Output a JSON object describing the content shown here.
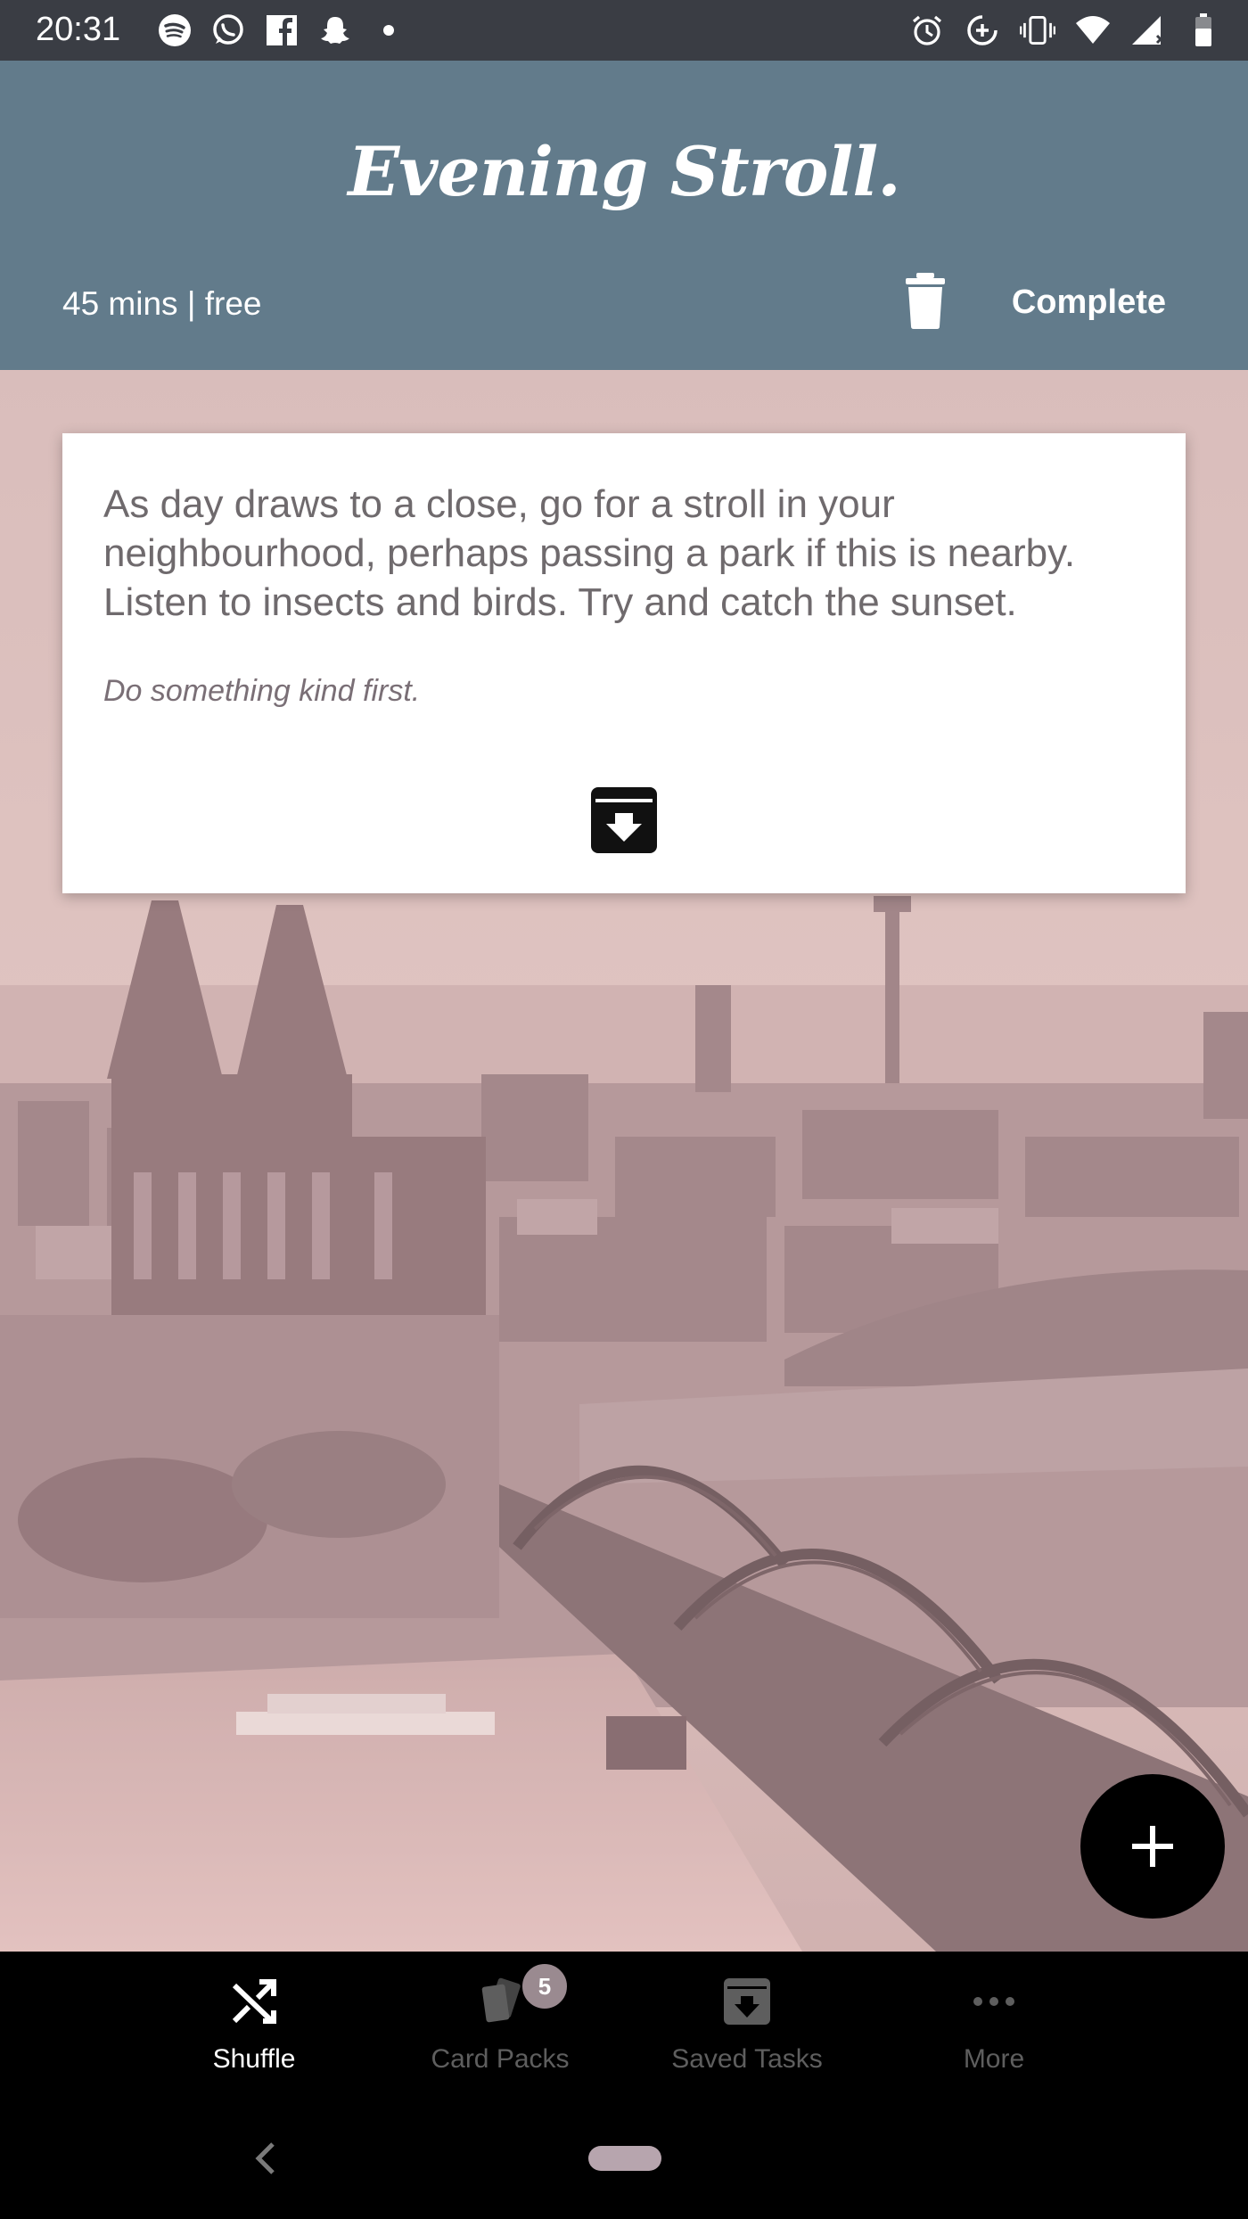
{
  "status_bar": {
    "time": "20:31",
    "left_icons": [
      "spotify-icon",
      "whatsapp-icon",
      "facebook-icon",
      "snapchat-icon",
      "dot-icon"
    ],
    "right_icons": [
      "alarm-icon",
      "data-saver-icon",
      "vibrate-icon",
      "wifi-icon",
      "signal-icon",
      "battery-icon"
    ]
  },
  "header": {
    "title": "Evening Stroll.",
    "info": "45 mins | free",
    "delete_icon": "trash-icon",
    "complete_label": "Complete"
  },
  "card": {
    "description": "As day draws to a close, go for a stroll in your neighbourhood, perhaps passing a park if this is nearby. Listen to insects and birds. Try and catch the sunset.",
    "hint": "Do something kind first.",
    "save_icon": "archive-download-icon"
  },
  "fab": {
    "icon": "plus-icon"
  },
  "bottom_nav": {
    "items": [
      {
        "label": "Shuffle",
        "icon": "shuffle-icon",
        "active": true
      },
      {
        "label": "Card Packs",
        "icon": "cards-icon",
        "badge": "5",
        "active": false
      },
      {
        "label": "Saved Tasks",
        "icon": "archive-icon",
        "active": false
      },
      {
        "label": "More",
        "icon": "more-dots-icon",
        "active": false
      }
    ]
  },
  "colors": {
    "header_bg": "#627b8b",
    "status_bar_bg": "#3a3d44",
    "nav_active": "#ffffff",
    "nav_inactive": "#5e5e5e",
    "scene_tint": "#dcb8b6"
  }
}
